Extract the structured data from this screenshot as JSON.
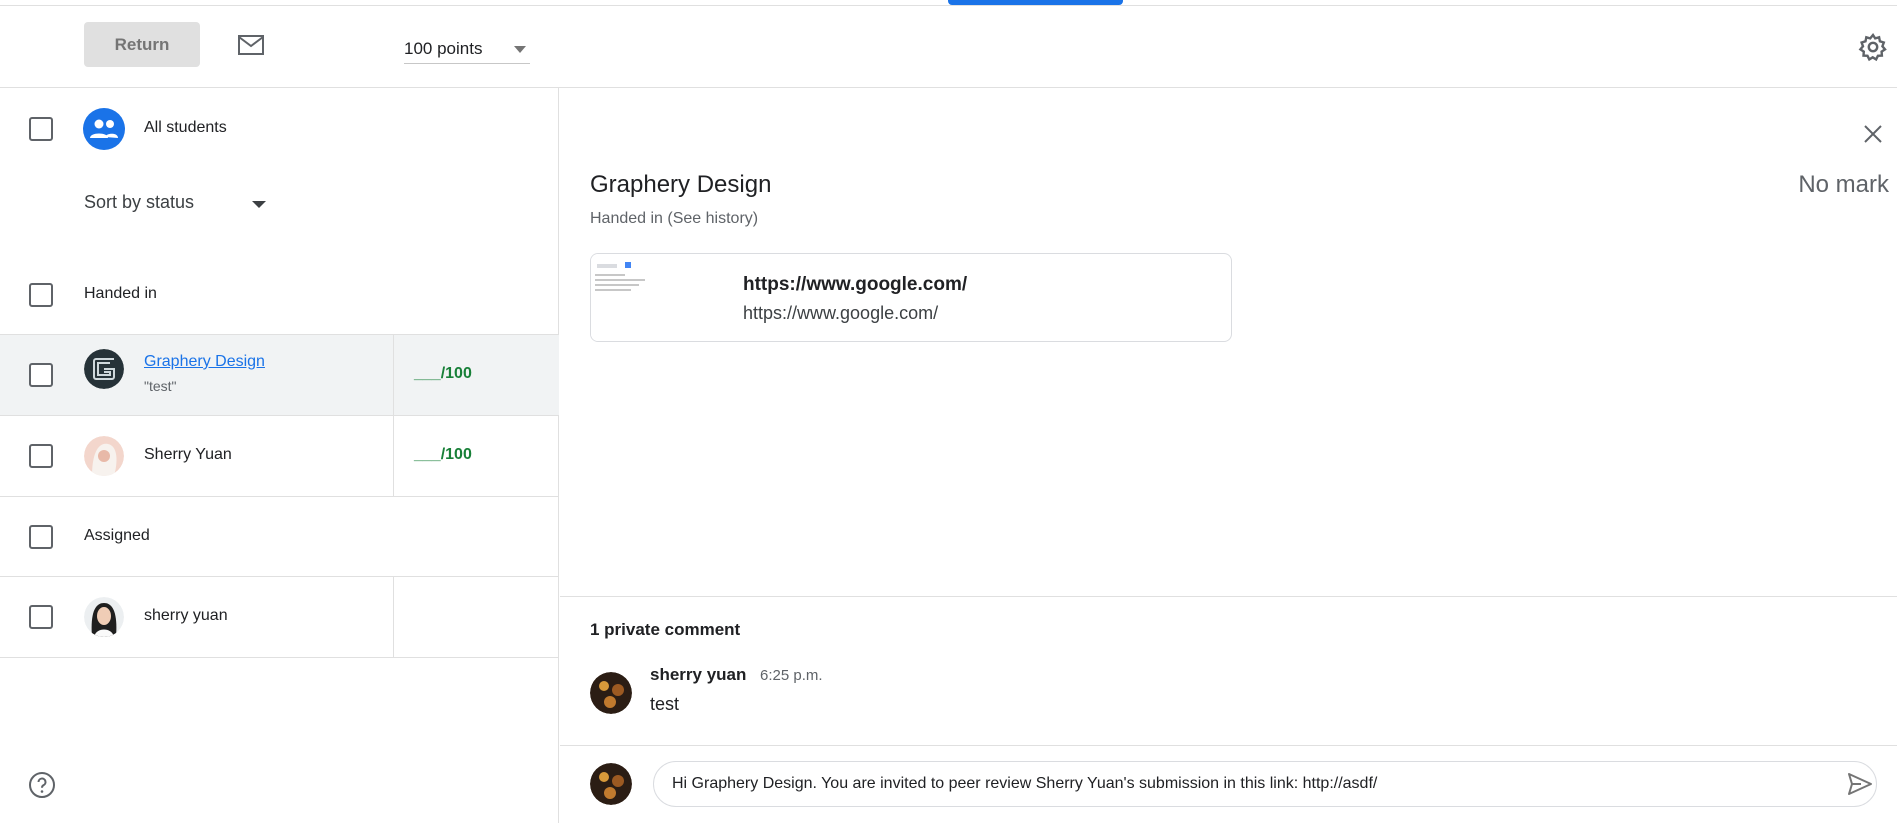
{
  "toolbar": {
    "return_label": "Return",
    "points_value": "100 points"
  },
  "roster": {
    "all_students_label": "All students",
    "sort_label": "Sort by status",
    "sections": [
      {
        "label": "Handed in"
      },
      {
        "label": "Assigned"
      }
    ],
    "students": [
      {
        "name": "Graphery Design",
        "subtext": "\"test\"",
        "grade": "___/100",
        "selected": true
      },
      {
        "name": "Sherry Yuan",
        "subtext": "",
        "grade": "___/100",
        "selected": false
      },
      {
        "name": "sherry yuan",
        "subtext": "",
        "grade": "",
        "selected": false
      }
    ]
  },
  "detail": {
    "student_name": "Graphery Design",
    "mark": "No mark",
    "status_prefix": "Handed in",
    "history_link": "(See history)",
    "attachment": {
      "title": "https://www.google.com/",
      "url": "https://www.google.com/"
    }
  },
  "comments": {
    "header": "1 private comment",
    "items": [
      {
        "author": "sherry yuan",
        "time": "6:25 p.m.",
        "text": "test"
      }
    ],
    "draft": "Hi Graphery Design. You are invited to peer review Sherry Yuan's submission in this link: http://asdf/"
  },
  "colors": {
    "accent": "#1a73e8",
    "grade_green": "#188038"
  },
  "icons": {
    "mail": "mail-icon",
    "gear": "gear-icon",
    "close": "close-icon",
    "help": "help-icon",
    "send": "send-icon",
    "group": "group-icon"
  }
}
